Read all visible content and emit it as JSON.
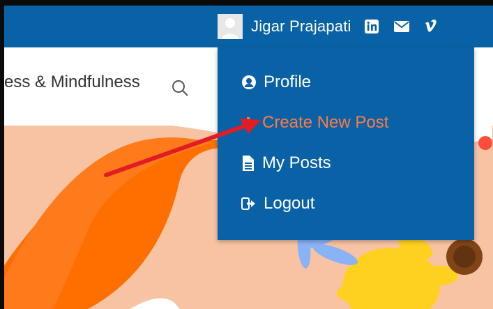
{
  "header": {
    "username": "Jigar Prajapati",
    "social_icons": [
      "linkedin-icon",
      "mail-icon",
      "vimeo-icon"
    ],
    "bg_color": "#0a62a6"
  },
  "nav": {
    "label": "ess & Mindfulness",
    "search_icon": "search-icon"
  },
  "dropdown": {
    "items": [
      {
        "label": "Profile",
        "icon": "user-circle-icon",
        "active": false
      },
      {
        "label": "Create New Post",
        "icon": "plus-icon",
        "active": true
      },
      {
        "label": "My Posts",
        "icon": "file-icon",
        "active": false
      },
      {
        "label": "Logout",
        "icon": "logout-icon",
        "active": false
      }
    ],
    "active_color": "#ff7a45"
  },
  "annotation": {
    "arrow_color": "#e31b23"
  }
}
